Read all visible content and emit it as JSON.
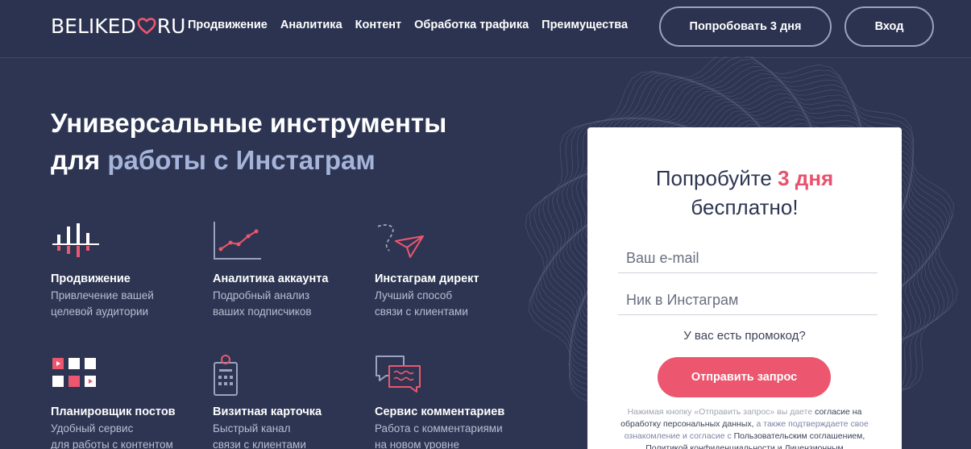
{
  "header": {
    "logo_left": "BELIKED",
    "logo_right": "RU",
    "nav": [
      "Продвижение",
      "Аналитика",
      "Контент",
      "Обработка трафика",
      "Преимущества"
    ],
    "try_button": "Попробовать 3 дня",
    "login_button": "Вход"
  },
  "hero": {
    "title_line1": "Универсальные инструменты",
    "title_line2_plain": "для",
    "title_line2_accent": "работы с Инстаграм"
  },
  "features": [
    {
      "icon": "bars-chart-icon",
      "title": "Продвижение",
      "desc1": "Привлечение вашей",
      "desc2": "целевой аудитории"
    },
    {
      "icon": "line-chart-icon",
      "title": "Аналитика аккаунта",
      "desc1": "Подробный анализ",
      "desc2": "ваших подписчиков"
    },
    {
      "icon": "paper-plane-icon",
      "title": "Инстаграм директ",
      "desc1": "Лучший способ",
      "desc2": "связи с клиентами"
    },
    {
      "icon": "calendar-grid-icon",
      "title": "Планировщик постов",
      "desc1": "Удобный сервис",
      "desc2": "для работы с контентом"
    },
    {
      "icon": "business-card-icon",
      "title": "Визитная карточка",
      "desc1": "Быстрый канал",
      "desc2": "связи с клиентами"
    },
    {
      "icon": "chat-bubbles-icon",
      "title": "Сервис комментариев",
      "desc1": "Работа с комментариями",
      "desc2": "на новом уровне"
    }
  ],
  "form": {
    "title_pre": "Попробуйте",
    "title_highlight": "3 дня",
    "title_post": "бесплатно!",
    "email_placeholder": "Ваш e-mail",
    "nick_placeholder": "Ник в Инстаграм",
    "promo_link": "У вас есть промокод?",
    "submit": "Отправить запрос",
    "consent": {
      "p1": "Нажимая кнопку «Отправить запрос» вы даете",
      "p2": "согласие на обработку персональных данных,",
      "p3": "а также подтверждаете свое ознакомление и согласие с",
      "p4": "Пользовательским соглашением, Политикой конфиденциальности и Лицензионным"
    }
  },
  "colors": {
    "background": "#2d3552",
    "accent_pink": "#ec566f",
    "accent_blue": "#a6b4da",
    "card": "#ffffff"
  }
}
